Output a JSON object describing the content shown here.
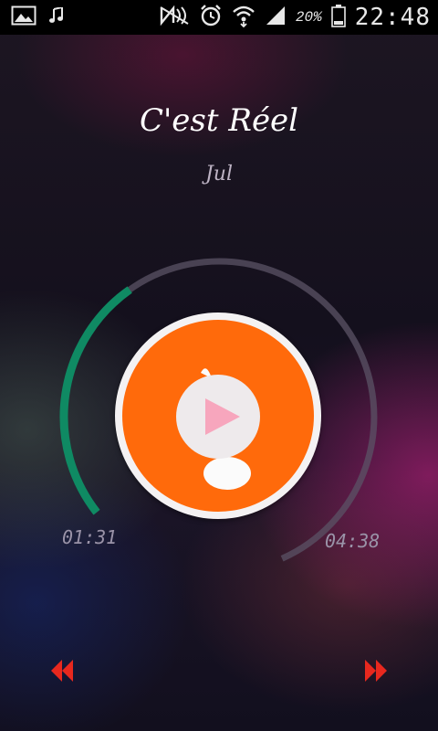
{
  "status_bar": {
    "time": "22:48",
    "battery_percent": "20%",
    "left_icons": [
      "gallery-icon",
      "music-note-icon"
    ],
    "right_icons": [
      "nfc-icon",
      "alarm-icon",
      "wifi-icon",
      "signal-icon",
      "battery-icon"
    ]
  },
  "track": {
    "title": "C'est Réel",
    "artist": "Jul"
  },
  "playback": {
    "elapsed": "01:31",
    "total": "04:38",
    "progress_fraction": 0.327,
    "state": "paused"
  },
  "controls": {
    "play_icon": "play-icon",
    "prev_icon": "rewind-icon",
    "next_icon": "fast-forward-icon"
  },
  "colors": {
    "accent_disc": "#ff6a0b",
    "progress": "#0f8a63",
    "track": "#5b5366",
    "play_triangle": "#f7a6bd",
    "nav_buttons": "#e8281e"
  }
}
